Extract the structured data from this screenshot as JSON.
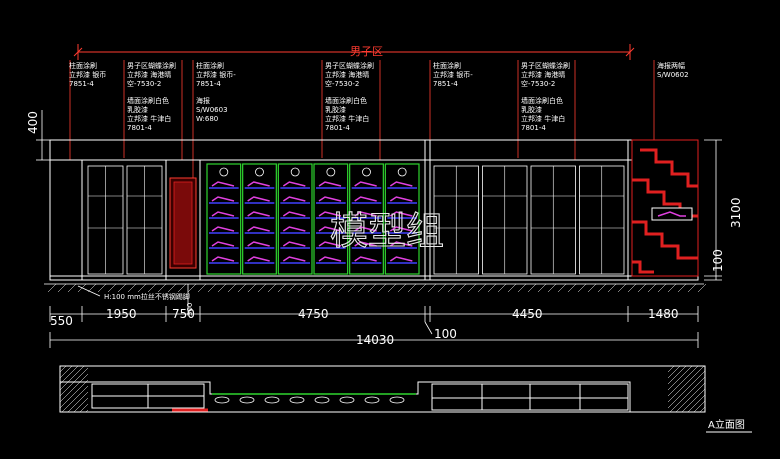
{
  "zone_label": "男子区",
  "watermark": "模型组",
  "drawing_title": "A立面图",
  "annotations": {
    "a1": [
      "柱面涂刷",
      "立邦漆 银币",
      "7851-4"
    ],
    "a2": [
      "男子区蝴蝶涂刷",
      "立邦漆 海港晴",
      "空-7530-2"
    ],
    "a3": [
      "墙面涂刷白色",
      "乳胶漆",
      "立邦漆 牛津白",
      "7801-4"
    ],
    "a4": [
      "柱面涂刷",
      "立邦漆 银币-",
      "7851-4"
    ],
    "a5": [
      "海报",
      "S/W0603",
      "W:680"
    ],
    "a6": [
      "男子区蝴蝶涂刷",
      "立邦漆 海港晴",
      "空-7530-2"
    ],
    "a7": [
      "墙面涂刷白色",
      "乳胶漆",
      "立邦漆 牛津白",
      "7801-4"
    ],
    "a8": [
      "柱面涂刷",
      "立邦漆 银币-",
      "7851-4"
    ],
    "a9": [
      "男子区蝴蝶涂刷",
      "立邦漆 海港晴",
      "空-7530-2"
    ],
    "a10": [
      "墙面涂刷白色",
      "乳胶漆",
      "立邦漆 牛津白",
      "7801-4"
    ],
    "a11": [
      "海报两幅",
      "S/W0602"
    ]
  },
  "note_bottom": "H:100 mm拉丝不锈钢踢脚",
  "dims": {
    "left_height": "400",
    "total_height": "3100",
    "base_height": "100",
    "small_vertical": "300",
    "d550": "550",
    "d1950": "1950",
    "d750": "750",
    "d4750": "4750",
    "d4450": "4450",
    "d1480": "1480",
    "d100": "100",
    "total_width": "14030"
  },
  "colors": {
    "background": "#000000",
    "line": "#ffffff",
    "dimension_red": "#ff3b30",
    "display_green": "#2fd52f",
    "shelf_blue": "#4040ff",
    "product_magenta": "#e040e0",
    "accent_red": "#e02020"
  }
}
